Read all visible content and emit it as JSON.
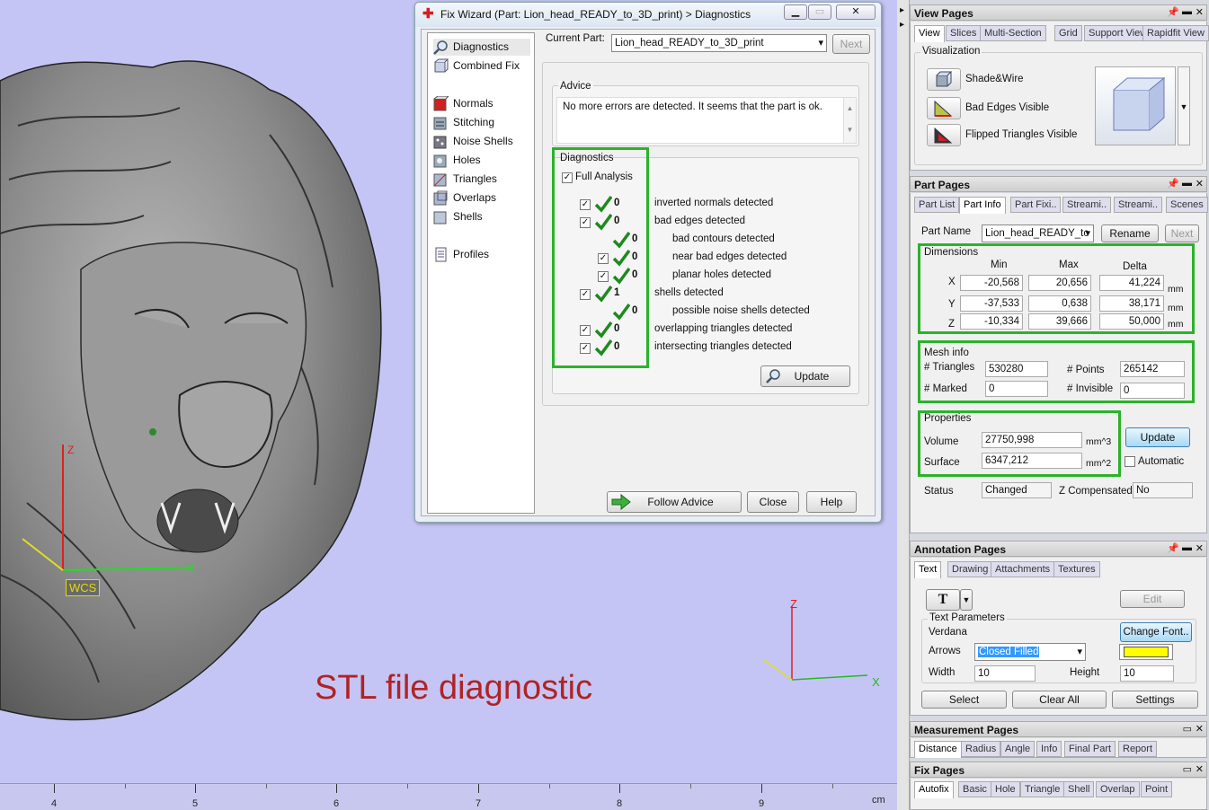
{
  "viewport": {
    "overlay_text": "STL file diagnostic",
    "wcs_label": "WCS",
    "axis_z": "Z",
    "axis_x": "X",
    "ruler_labels": [
      "4",
      "5",
      "6",
      "7",
      "8",
      "9"
    ],
    "ruler_unit": "cm"
  },
  "dialog": {
    "title": "Fix Wizard (Part: Lion_head_READY_to_3D_print) > Diagnostics",
    "nav": {
      "diagnostics": "Diagnostics",
      "combined_fix": "Combined Fix",
      "normals": "Normals",
      "stitching": "Stitching",
      "noise_shells": "Noise Shells",
      "holes": "Holes",
      "triangles": "Triangles",
      "overlaps": "Overlaps",
      "shells": "Shells",
      "profiles": "Profiles"
    },
    "current_part_label": "Current Part:",
    "current_part_value": "Lion_head_READY_to_3D_print",
    "next_label": "Next",
    "advice_label": "Advice",
    "advice_text": "No more errors are detected. It seems that the part is ok.",
    "diagnostics_label": "Diagnostics",
    "full_analysis_label": "Full Analysis",
    "rows": [
      {
        "count": "0",
        "label": "inverted normals detected"
      },
      {
        "count": "0",
        "label": "bad edges detected"
      },
      {
        "count": "0",
        "label": "bad contours detected"
      },
      {
        "count": "0",
        "label": "near bad edges detected"
      },
      {
        "count": "0",
        "label": "planar holes detected"
      },
      {
        "count": "1",
        "label": "shells detected"
      },
      {
        "count": "0",
        "label": "possible noise shells detected"
      },
      {
        "count": "0",
        "label": "overlapping triangles detected"
      },
      {
        "count": "0",
        "label": "intersecting triangles detected"
      }
    ],
    "update_label": "Update",
    "follow_advice_label": "Follow Advice",
    "close_label": "Close",
    "help_label": "Help"
  },
  "view_pages": {
    "title": "View Pages",
    "tabs": [
      "View",
      "Slices",
      "Multi-Section",
      "Grid",
      "Support View",
      "Rapidfit View"
    ],
    "visualization_label": "Visualization",
    "shade_wire": "Shade&Wire",
    "bad_edges": "Bad Edges Visible",
    "flipped_triangles": "Flipped Triangles Visible"
  },
  "part_pages": {
    "title": "Part Pages",
    "tabs": [
      "Part List",
      "Part Info",
      "Part Fixi..",
      "Streami..",
      "Streami..",
      "Scenes"
    ],
    "part_name_label": "Part Name",
    "part_name_value": "Lion_head_READY_tc",
    "rename_label": "Rename",
    "next_label": "Next",
    "dimensions_label": "Dimensions",
    "col_min": "Min",
    "col_max": "Max",
    "col_delta": "Delta",
    "dims": [
      {
        "axis": "X",
        "min": "-20,568",
        "max": "20,656",
        "delta": "41,224",
        "unit": "mm"
      },
      {
        "axis": "Y",
        "min": "-37,533",
        "max": "0,638",
        "delta": "38,171",
        "unit": "mm"
      },
      {
        "axis": "Z",
        "min": "-10,334",
        "max": "39,666",
        "delta": "50,000",
        "unit": "mm"
      }
    ],
    "mesh_info_label": "Mesh info",
    "triangles_label": "# Triangles",
    "triangles_value": "530280",
    "points_label": "# Points",
    "points_value": "265142",
    "marked_label": "# Marked",
    "marked_value": "0",
    "invisible_label": "# Invisible",
    "invisible_value": "0",
    "properties_label": "Properties",
    "volume_label": "Volume",
    "volume_value": "27750,998",
    "volume_unit": "mm^3",
    "surface_label": "Surface",
    "surface_value": "6347,212",
    "surface_unit": "mm^2",
    "update_label": "Update",
    "automatic_label": "Automatic",
    "status_label": "Status",
    "status_value": "Changed",
    "zcomp_label": "Z Compensated",
    "zcomp_value": "No"
  },
  "annotation_pages": {
    "title": "Annotation Pages",
    "tabs": [
      "Text",
      "Drawing",
      "Attachments",
      "Textures"
    ],
    "text_tool": "T",
    "edit_label": "Edit",
    "text_params_label": "Text Parameters",
    "font_name": "Verdana",
    "change_font_label": "Change Font..",
    "arrows_label": "Arrows",
    "arrows_value": "Closed Filled",
    "color_value": "#ffff00",
    "width_label": "Width",
    "width_value": "10",
    "height_label": "Height",
    "height_value": "10",
    "select_label": "Select",
    "clear_all_label": "Clear All",
    "settings_label": "Settings"
  },
  "measurement_pages": {
    "title": "Measurement Pages",
    "tabs": [
      "Distance",
      "Radius",
      "Angle",
      "Info",
      "Final Part",
      "Report"
    ]
  },
  "fix_pages": {
    "title": "Fix Pages",
    "tabs": [
      "Autofix",
      "Basic",
      "Hole",
      "Triangle",
      "Shell",
      "Overlap",
      "Point"
    ]
  }
}
